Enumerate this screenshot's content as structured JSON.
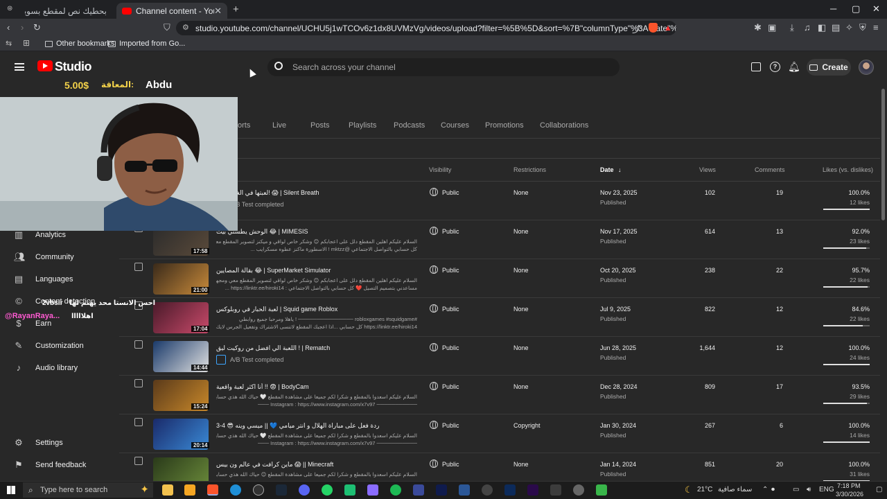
{
  "browser": {
    "tabs": [
      {
        "title": "بحطيك نص لمقطع بسويه واذا تبي حد..."
      },
      {
        "title": "Channel content - YouTube Studio"
      }
    ],
    "new_tab": "+",
    "window_controls": [
      "─",
      "▢",
      "✕"
    ],
    "url": "studio.youtube.com/channel/UCHU5j1wTCOv6z1dx8UVMzVg/videos/upload?filter=%5B%5D&sort=%7B\"columnType\"%3A\"date\"%2C\"sortOrder\"%3...",
    "bookmarks": [
      "Other bookmarks",
      "Imported from Go..."
    ]
  },
  "header": {
    "logo": "Studio",
    "search_placeholder": "Search across your channel",
    "create_label": "Create"
  },
  "overlay": {
    "donation_label": "المعاقة:",
    "donation_amount": "5.00$",
    "donor_name": "Abdu",
    "chat_text": "احس الانستا محد يهتم لها",
    "chat_user": "2vbsir",
    "username": "@RayanRaya...",
    "greeting": "اهلااااا"
  },
  "sidebar": {
    "items": [
      {
        "label": "Analytics"
      },
      {
        "label": "Community"
      },
      {
        "label": "Languages"
      },
      {
        "label": "Content detection"
      },
      {
        "label": "Earn"
      },
      {
        "label": "Customization"
      },
      {
        "label": "Audio library"
      },
      {
        "label": "Settings"
      },
      {
        "label": "Send feedback"
      }
    ]
  },
  "content_tabs": [
    "orts",
    "Live",
    "Posts",
    "Playlists",
    "Podcasts",
    "Courses",
    "Promotions",
    "Collaborations"
  ],
  "columns": {
    "visibility": "Visibility",
    "restrictions": "Restrictions",
    "date": "Date",
    "date_arrow": "↓",
    "views": "Views",
    "comments": "Comments",
    "likes": "Likes (vs. dislikes)"
  },
  "videos": [
    {
      "title": "لعبتها في الغابة.. وما! 😱 | Silent Breath",
      "ab": "A/B Test completed",
      "desc1": "",
      "desc2": "",
      "duration": "",
      "visibility": "Public",
      "restrictions": "None",
      "date": "Nov 23, 2025",
      "status": "Published",
      "views": "102",
      "comments": "19",
      "likes_pct": "100.0%",
      "likes_count": "12 likes",
      "ratio": 1.0
    },
    {
      "title": "الوحش يطسني بيت 😂 | MIMESIS",
      "ab": "",
      "desc1": "السلام عليكم اهلين المقطع دلل على اعجابكم 😊 وشكر خاص لواقي و ميكنز لتصوير المقطع معي ❤️ اقاه",
      "desc2": "كل حسابي بالتواصل الاجتماعي @mktzz ! الاسطورة ماكنز عطوه مسكرايب ...",
      "duration": "17:58",
      "visibility": "Public",
      "restrictions": "None",
      "date": "Nov 17, 2025",
      "status": "Published",
      "views": "614",
      "comments": "13",
      "likes_pct": "92.0%",
      "likes_count": "23 likes",
      "ratio": 0.92
    },
    {
      "title": "بقالة المصايين 😂 | SuperMarket Simulator",
      "ab": "",
      "desc1": "السلام عليكم اهلين المقطع دلل على اعجابكم 😊 وشكر خاص لواقي لتصوير المقطع معي ومجهزك على",
      "desc2": "مساعدني بتصميم التصيل ❤️ كل حسابي بالتواصل الاجتماعي : https://linktr.ee/hiroki14 ...",
      "duration": "21:00",
      "visibility": "Public",
      "restrictions": "None",
      "date": "Oct 20, 2025",
      "status": "Published",
      "views": "238",
      "comments": "22",
      "likes_pct": "95.7%",
      "likes_count": "22 likes",
      "ratio": 0.957
    },
    {
      "title": "لعبة الحبار في روبلوكس | Squid game Roblox",
      "ab": "",
      "desc1": "#robloxgames #squidgame ─────────────── ! ياهلا ومرحبا جميع روابطي",
      "desc2": "https://linktr.ee/hiroki14 كل حسابي ...اذا اعجبك المقطع لاتنسى الاشتراك وتفعيل الجرس لايك",
      "duration": "17:04",
      "visibility": "Public",
      "restrictions": "None",
      "date": "Jul 9, 2025",
      "status": "Published",
      "views": "822",
      "comments": "12",
      "likes_pct": "84.6%",
      "likes_count": "22 likes",
      "ratio": 0.846
    },
    {
      "title": "اللعبة الي افضل من روكيت ليق ! | Rematch",
      "ab": "A/B Test completed",
      "desc1": "",
      "desc2": "",
      "duration": "14:44",
      "visibility": "Public",
      "restrictions": "None",
      "date": "Jun 28, 2025",
      "status": "Published",
      "views": "1,644",
      "comments": "12",
      "likes_pct": "100.0%",
      "likes_count": "24 likes",
      "ratio": 1.0
    },
    {
      "title": "أنا اكثر لعبة واقعية !! 😨 | BodyCam",
      "ab": "",
      "desc1": "السلام عليكم اسعدوا بالمقطع و شكرا لكم جميعا على مشاهدة المقطع 🤍 حياك الله هذي حساباتي الخاصة",
      "desc2": "─────────── Instagram : https://www.instagram.com/x7v97 ───",
      "duration": "15:24",
      "visibility": "Public",
      "restrictions": "None",
      "date": "Dec 28, 2024",
      "status": "Published",
      "views": "809",
      "comments": "17",
      "likes_pct": "93.5%",
      "likes_count": "29 likes",
      "ratio": 0.935
    },
    {
      "title": "ردة فعل على مباراة الهلال و انتر ميامي 💙 || ميسي وينه 😎 4-3",
      "ab": "",
      "desc1": "السلام عليكم اسعدوا بالمقطع و شكرا لكم جميعا على مشاهدة المقطع 🤍 حياك الله هذي حساباتي الخاصة",
      "desc2": "─────────── Instagram : https://www.instagram.com/x7v97 ───",
      "duration": "20:14",
      "visibility": "Public",
      "restrictions": "Copyright",
      "date": "Jan 30, 2024",
      "status": "Published",
      "views": "267",
      "comments": "6",
      "likes_pct": "100.0%",
      "likes_count": "14 likes",
      "ratio": 1.0
    },
    {
      "title": "ماين كرافت في عالم ون بيس 😱 || Minecraft",
      "ab": "",
      "desc1": "السلام عليكم اسعدوا بالمقطع و شكرا لكم جميعا على مشاهدة المقطع 😊 حياك الله هذي حساباتي الخاصة",
      "desc2": "",
      "duration": "",
      "visibility": "Public",
      "restrictions": "None",
      "date": "Jan 14, 2024",
      "status": "Published",
      "views": "851",
      "comments": "20",
      "likes_pct": "100.0%",
      "likes_count": "31 likes",
      "ratio": 1.0
    }
  ],
  "taskbar": {
    "search_placeholder": "Type here to search",
    "weather": "21°C",
    "weather_desc": "سماء صافية",
    "lang": "ENG",
    "time": "7:18 PM",
    "date": "3/30/2026"
  },
  "colors": {
    "accent": "#3ea6ff",
    "brand": "#ff0000",
    "bg": "#282828"
  }
}
